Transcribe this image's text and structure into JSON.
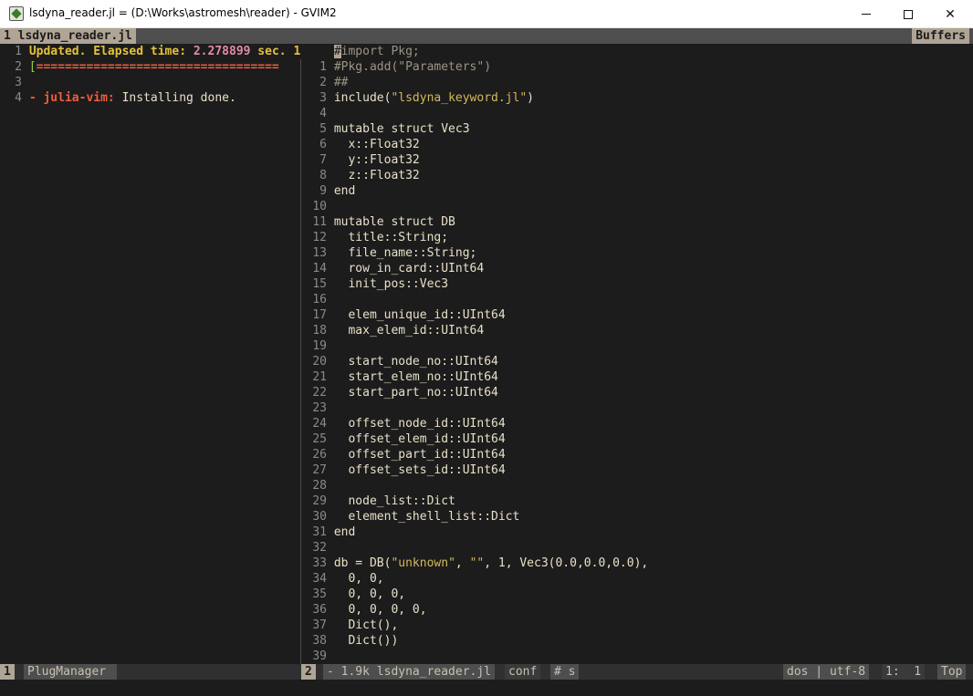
{
  "window": {
    "title": "lsdyna_reader.jl = (D:\\Works\\astromesh\\reader) - GVIM2",
    "buttons": {
      "minimize": "minimize",
      "maximize": "maximize",
      "close": "✕"
    }
  },
  "tabline": {
    "active_tab": "1 lsdyna_reader.jl",
    "buffers_label": "Buffers"
  },
  "left_pane": {
    "lines": [
      {
        "num": "1",
        "parts": [
          {
            "text": "Updated. Elapsed ",
            "style": "c-yellow"
          },
          {
            "text": "time",
            "style": "c-yellow"
          },
          {
            "text": ": ",
            "style": "c-yellow"
          },
          {
            "text": "2.278899",
            "style": "c-pink"
          },
          {
            "text": " sec. ",
            "style": "c-yellow"
          },
          {
            "text": "1",
            "style": "c-yellow"
          }
        ]
      },
      {
        "num": "2",
        "parts": [
          {
            "text": "[",
            "style": "c-green"
          },
          {
            "text": "==================================",
            "style": "c-red"
          }
        ]
      },
      {
        "num": "3",
        "parts": []
      },
      {
        "num": "4",
        "parts": [
          {
            "text": "- ",
            "style": "c-red"
          },
          {
            "text": "julia-vim:",
            "style": "c-red"
          },
          {
            "text": " Installing done.",
            "style": "c-code"
          }
        ]
      }
    ]
  },
  "right_pane": {
    "lines": [
      {
        "num": "",
        "parts": [
          {
            "text": "#",
            "style": "cursor"
          },
          {
            "text": "import Pkg;",
            "style": "c-comment"
          }
        ]
      },
      {
        "num": "1",
        "parts": [
          {
            "text": "#Pkg.add(\"Parameters\")",
            "style": "c-comment"
          }
        ]
      },
      {
        "num": "2",
        "parts": [
          {
            "text": "##",
            "style": "c-comment"
          }
        ]
      },
      {
        "num": "3",
        "parts": [
          {
            "text": "include(",
            "style": "c-code"
          },
          {
            "text": "\"lsdyna_keyword.jl\"",
            "style": "c-str"
          },
          {
            "text": ")",
            "style": "c-code"
          }
        ]
      },
      {
        "num": "4",
        "parts": []
      },
      {
        "num": "5",
        "parts": [
          {
            "text": "mutable struct Vec3",
            "style": "c-code"
          }
        ]
      },
      {
        "num": "6",
        "parts": [
          {
            "text": "  x::Float32",
            "style": "c-code"
          }
        ]
      },
      {
        "num": "7",
        "parts": [
          {
            "text": "  y::Float32",
            "style": "c-code"
          }
        ]
      },
      {
        "num": "8",
        "parts": [
          {
            "text": "  z::Float32",
            "style": "c-code"
          }
        ]
      },
      {
        "num": "9",
        "parts": [
          {
            "text": "end",
            "style": "c-code"
          }
        ]
      },
      {
        "num": "10",
        "parts": []
      },
      {
        "num": "11",
        "parts": [
          {
            "text": "mutable struct DB",
            "style": "c-code"
          }
        ]
      },
      {
        "num": "12",
        "parts": [
          {
            "text": "  title::String;",
            "style": "c-code"
          }
        ]
      },
      {
        "num": "13",
        "parts": [
          {
            "text": "  file_name::String;",
            "style": "c-code"
          }
        ]
      },
      {
        "num": "14",
        "parts": [
          {
            "text": "  row_in_card::UInt64",
            "style": "c-code"
          }
        ]
      },
      {
        "num": "15",
        "parts": [
          {
            "text": "  init_pos::Vec3",
            "style": "c-code"
          }
        ]
      },
      {
        "num": "16",
        "parts": []
      },
      {
        "num": "17",
        "parts": [
          {
            "text": "  elem_unique_id::UInt64",
            "style": "c-code"
          }
        ]
      },
      {
        "num": "18",
        "parts": [
          {
            "text": "  max_elem_id::UInt64",
            "style": "c-code"
          }
        ]
      },
      {
        "num": "19",
        "parts": []
      },
      {
        "num": "20",
        "parts": [
          {
            "text": "  start_node_no::UInt64",
            "style": "c-code"
          }
        ]
      },
      {
        "num": "21",
        "parts": [
          {
            "text": "  start_elem_no::UInt64",
            "style": "c-code"
          }
        ]
      },
      {
        "num": "22",
        "parts": [
          {
            "text": "  start_part_no::UInt64",
            "style": "c-code"
          }
        ]
      },
      {
        "num": "23",
        "parts": []
      },
      {
        "num": "24",
        "parts": [
          {
            "text": "  offset_node_id::UInt64",
            "style": "c-code"
          }
        ]
      },
      {
        "num": "25",
        "parts": [
          {
            "text": "  offset_elem_id::UInt64",
            "style": "c-code"
          }
        ]
      },
      {
        "num": "26",
        "parts": [
          {
            "text": "  offset_part_id::UInt64",
            "style": "c-code"
          }
        ]
      },
      {
        "num": "27",
        "parts": [
          {
            "text": "  offset_sets_id::UInt64",
            "style": "c-code"
          }
        ]
      },
      {
        "num": "28",
        "parts": []
      },
      {
        "num": "29",
        "parts": [
          {
            "text": "  node_list::Dict",
            "style": "c-code"
          }
        ]
      },
      {
        "num": "30",
        "parts": [
          {
            "text": "  element_shell_list::Dict",
            "style": "c-code"
          }
        ]
      },
      {
        "num": "31",
        "parts": [
          {
            "text": "end",
            "style": "c-code"
          }
        ]
      },
      {
        "num": "32",
        "parts": []
      },
      {
        "num": "33",
        "parts": [
          {
            "text": "db = DB(",
            "style": "c-code"
          },
          {
            "text": "\"unknown\"",
            "style": "c-str"
          },
          {
            "text": ", ",
            "style": "c-code"
          },
          {
            "text": "\"\"",
            "style": "c-str"
          },
          {
            "text": ", 1, Vec3(0.0,0.0,0.0),",
            "style": "c-code"
          }
        ]
      },
      {
        "num": "34",
        "parts": [
          {
            "text": "  0, 0,",
            "style": "c-code"
          }
        ]
      },
      {
        "num": "35",
        "parts": [
          {
            "text": "  0, 0, 0,",
            "style": "c-code"
          }
        ]
      },
      {
        "num": "36",
        "parts": [
          {
            "text": "  0, 0, 0, 0,",
            "style": "c-code"
          }
        ]
      },
      {
        "num": "37",
        "parts": [
          {
            "text": "  Dict(),",
            "style": "c-code"
          }
        ]
      },
      {
        "num": "38",
        "parts": [
          {
            "text": "  Dict())",
            "style": "c-code"
          }
        ]
      },
      {
        "num": "39",
        "parts": []
      }
    ]
  },
  "statusline": {
    "left_num": "1",
    "left_name": "PlugManager",
    "right_num": "2",
    "right_file": "- 1.9k lsdyna_reader.jl",
    "filetype": "conf",
    "spaces": "# s",
    "encoding": "dos | utf-8",
    "position": "1:  1",
    "scroll": "Top"
  }
}
